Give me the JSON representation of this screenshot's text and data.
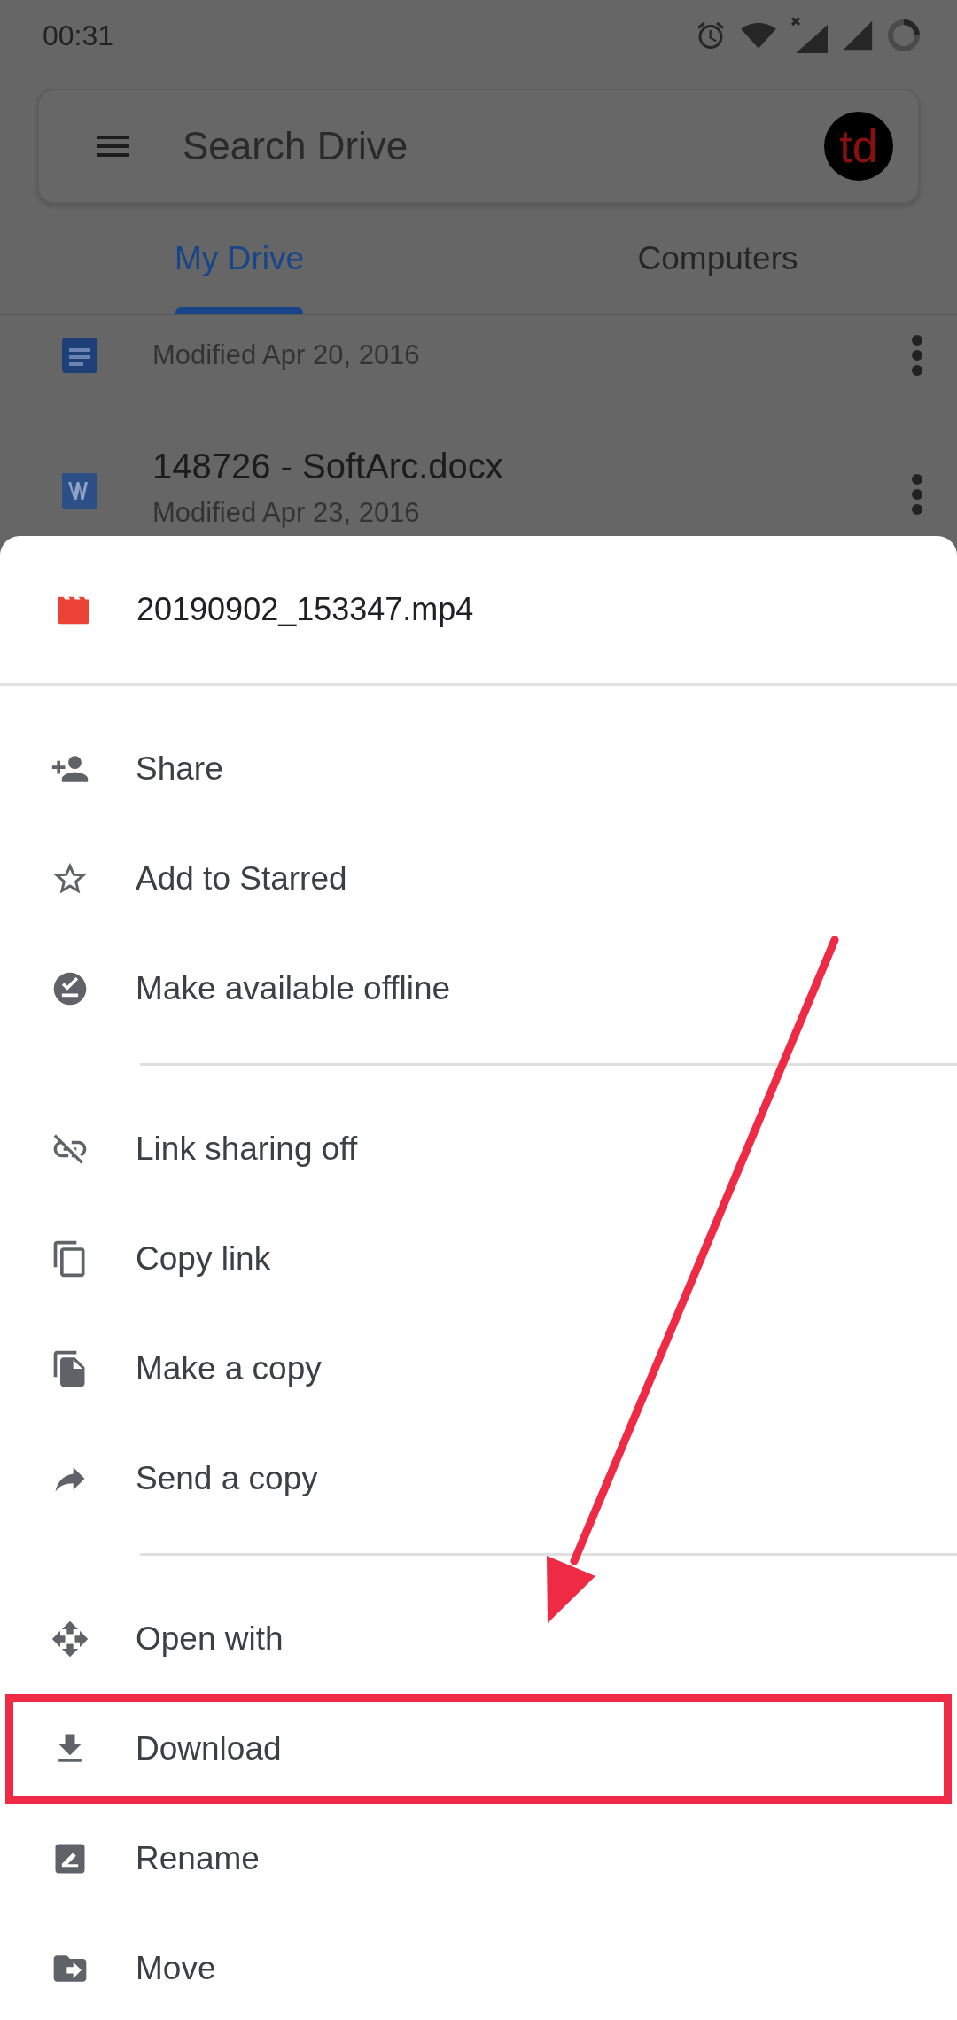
{
  "status_bar": {
    "time": "00:31"
  },
  "search": {
    "placeholder": "Search Drive",
    "avatar_initials": "td"
  },
  "tabs": [
    {
      "label": "My Drive",
      "selected": true
    },
    {
      "label": "Computers",
      "selected": false
    }
  ],
  "files": [
    {
      "kind": "doc",
      "modified": "Modified Apr 20, 2016"
    },
    {
      "kind": "word",
      "name": "148726 - SoftArc.docx",
      "modified": "Modified Apr 23, 2016"
    }
  ],
  "sheet": {
    "file": {
      "kind": "video",
      "name": "20190902_153347.mp4"
    },
    "groups": [
      [
        {
          "kind": "share",
          "label": "Share",
          "highlighted": false
        },
        {
          "kind": "star",
          "label": "Add to Starred",
          "highlighted": false
        },
        {
          "kind": "offline",
          "label": "Make available offline",
          "highlighted": false
        }
      ],
      [
        {
          "kind": "link-off",
          "label": "Link sharing off",
          "highlighted": false
        },
        {
          "kind": "copy-link",
          "label": "Copy link",
          "highlighted": false
        },
        {
          "kind": "make-copy",
          "label": "Make a copy",
          "highlighted": false
        },
        {
          "kind": "send",
          "label": "Send a copy",
          "highlighted": false
        }
      ],
      [
        {
          "kind": "open-with",
          "label": "Open with",
          "highlighted": false
        },
        {
          "kind": "download",
          "label": "Download",
          "highlighted": true
        },
        {
          "kind": "rename",
          "label": "Rename",
          "highlighted": false
        },
        {
          "kind": "move",
          "label": "Move",
          "highlighted": false
        }
      ]
    ]
  }
}
